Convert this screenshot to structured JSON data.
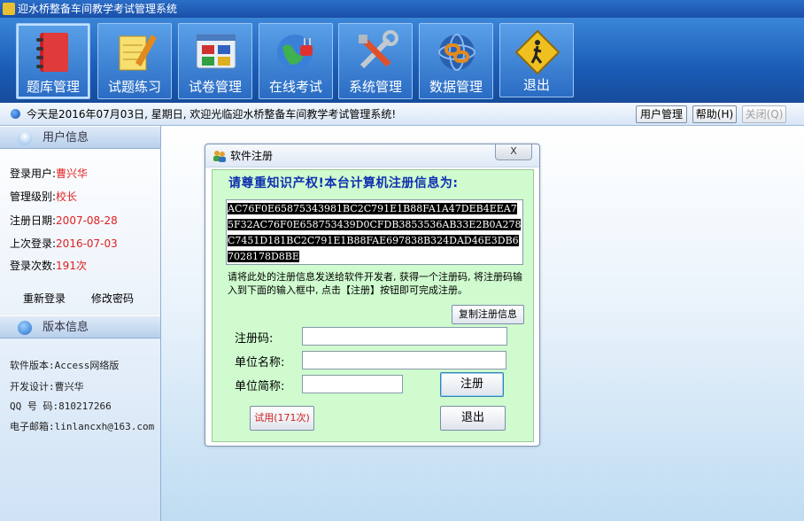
{
  "window": {
    "title": "迎水桥整备车间教学考试管理系统"
  },
  "toolbar": {
    "buttons": [
      {
        "label": "题库管理",
        "icon": "book-icon"
      },
      {
        "label": "试题练习",
        "icon": "notepad-pencil-icon"
      },
      {
        "label": "试卷管理",
        "icon": "window-grid-icon"
      },
      {
        "label": "在线考试",
        "icon": "globe-plug-icon"
      },
      {
        "label": "系统管理",
        "icon": "tools-icon"
      },
      {
        "label": "数据管理",
        "icon": "database-link-icon"
      },
      {
        "label": "退出",
        "icon": "exit-sign-icon"
      }
    ]
  },
  "infobar": {
    "message": "今天是2016年07月03日, 星期日, 欢迎光临迎水桥整备车间教学考试管理系统!",
    "user_mgmt": "用户管理",
    "help": "帮助(H)",
    "close": "关闭(Q)"
  },
  "user_panel": {
    "header": "用户信息",
    "rows": [
      {
        "key": "登录用户:",
        "value": "曹兴华"
      },
      {
        "key": "管理级别:",
        "value": "校长"
      },
      {
        "key": "注册日期:",
        "value": "2007-08-28"
      },
      {
        "key": "上次登录:",
        "value": "2016-07-03"
      },
      {
        "key": "登录次数:",
        "value": "191次"
      }
    ],
    "relogin": "重新登录",
    "change_pwd": "修改密码"
  },
  "version_panel": {
    "header": "版本信息",
    "rows": [
      "软件版本:Access网络版",
      "开发设计:曹兴华",
      "QQ 号 码:810217266",
      "电子邮箱:linlancxh@163.com"
    ]
  },
  "dialog": {
    "title": "软件注册",
    "close": "X",
    "heading": "请尊重知识产权!本台计算机注册信息为:",
    "code": "AC76F0E65875343981BC2C791E1B88FA1A47DEB4EEA75F32AC76F0E658753439D0CFDB3853536AB33E2B0A278C7451D181BC2C791E1B88FAE697838B324DAD46E3DB67028178D8BE",
    "hint": "请将此处的注册信息发送给软件开发者, 获得一个注册码, 将注册码输入到下面的输入框中, 点击【注册】按钮即可完成注册。",
    "copy_btn": "复制注册信息",
    "label_code": "注册码:",
    "label_unit": "单位名称:",
    "label_short": "单位简称:",
    "register_btn": "注册",
    "trial_btn": "试用(171次)",
    "exit_btn": "退出"
  }
}
